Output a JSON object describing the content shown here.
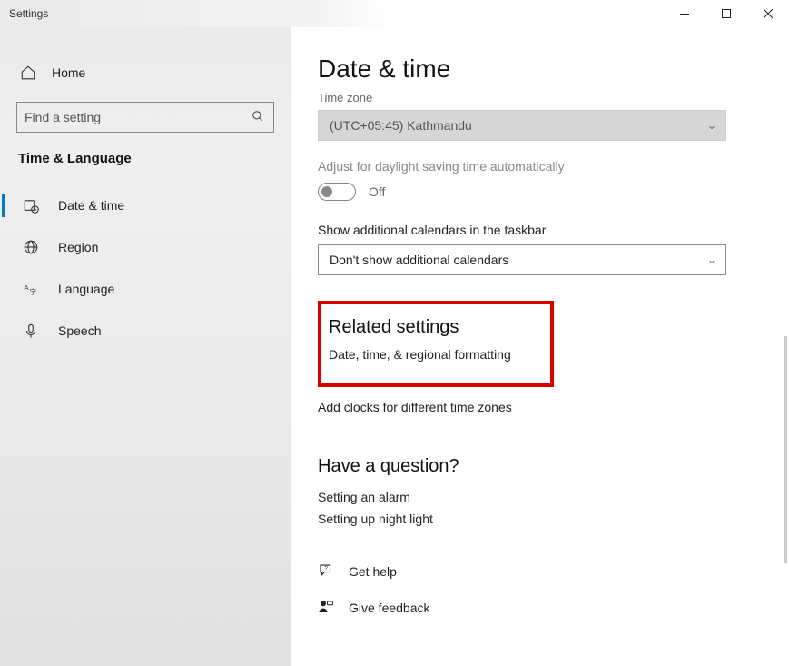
{
  "titlebar": {
    "title": "Settings"
  },
  "sidebar": {
    "home": "Home",
    "search_placeholder": "Find a setting",
    "category": "Time & Language",
    "items": [
      {
        "label": "Date & time"
      },
      {
        "label": "Region"
      },
      {
        "label": "Language"
      },
      {
        "label": "Speech"
      }
    ]
  },
  "main": {
    "title": "Date & time",
    "timezone_label": "Time zone",
    "timezone_value": "(UTC+05:45) Kathmandu",
    "dst_label": "Adjust for daylight saving time automatically",
    "dst_toggle_text": "Off",
    "additional_cal_label": "Show additional calendars in the taskbar",
    "additional_cal_value": "Don't show additional calendars",
    "related_title": "Related settings",
    "related_link1": "Date, time, & regional formatting",
    "related_link2": "Add clocks for different time zones",
    "question_title": "Have a question?",
    "question_link1": "Setting an alarm",
    "question_link2": "Setting up night light",
    "get_help": "Get help",
    "give_feedback": "Give feedback"
  }
}
